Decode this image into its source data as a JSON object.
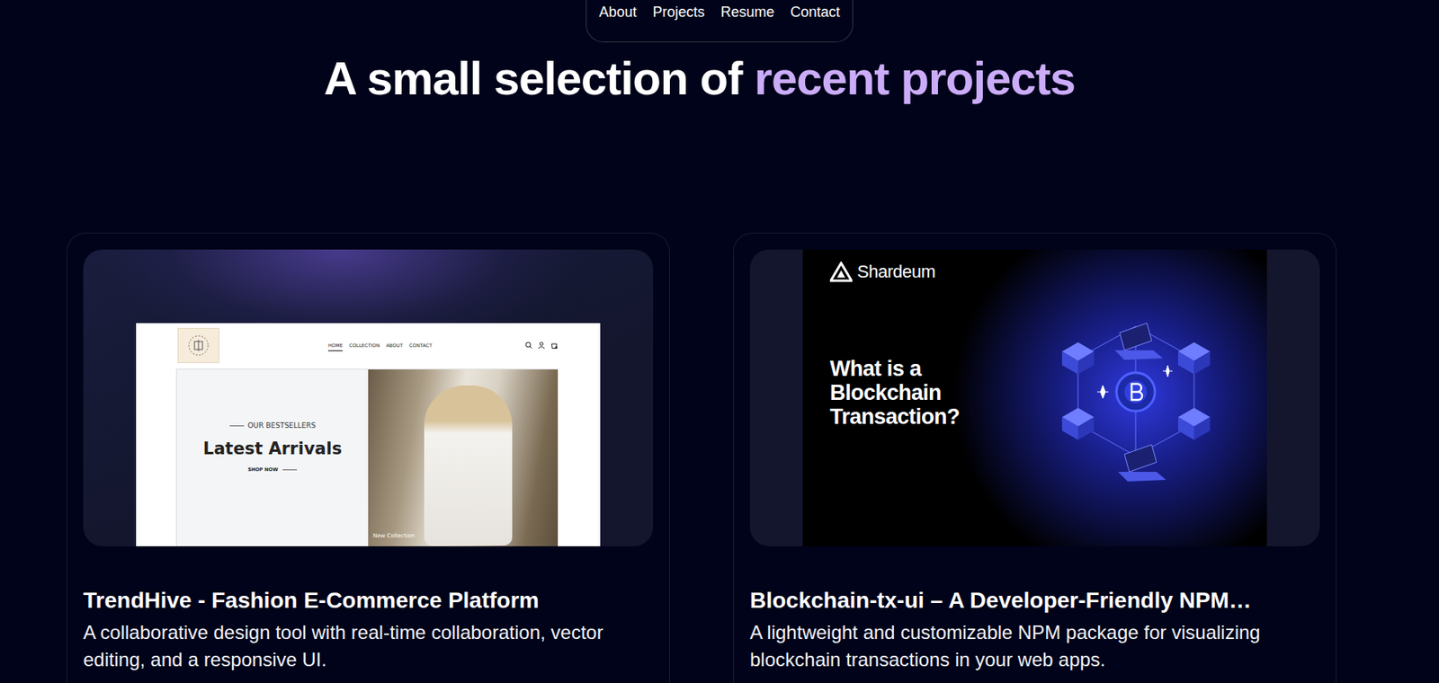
{
  "nav": {
    "items": [
      {
        "label": "About"
      },
      {
        "label": "Projects"
      },
      {
        "label": "Resume"
      },
      {
        "label": "Contact"
      }
    ]
  },
  "heading": {
    "text": "A small selection of ",
    "highlight": "recent projects"
  },
  "projects": [
    {
      "title": "TrendHive - Fashion E-Commerce Platform",
      "description": "A collaborative design tool with real-time collaboration, vector editing, and a responsive UI.",
      "thumbnail": {
        "kind": "storefront",
        "nav": [
          {
            "label": "HOME",
            "selected": true
          },
          {
            "label": "COLLECTION",
            "selected": false
          },
          {
            "label": "ABOUT",
            "selected": false
          },
          {
            "label": "CONTACT",
            "selected": false
          }
        ],
        "eyebrow": "OUR BESTSELLERS",
        "headline": "Latest Arrivals",
        "cta": "SHOP NOW",
        "badge": "New Collection"
      }
    },
    {
      "title": "Blockchain-tx-ui – A Developer-Friendly NPM…",
      "description": "A lightweight and customizable NPM package for visualizing blockchain transactions in your web apps.",
      "thumbnail": {
        "kind": "banner",
        "brand": "Shardeum",
        "headline": [
          "What is a",
          "Blockchain",
          "Transaction?"
        ]
      }
    }
  ]
}
